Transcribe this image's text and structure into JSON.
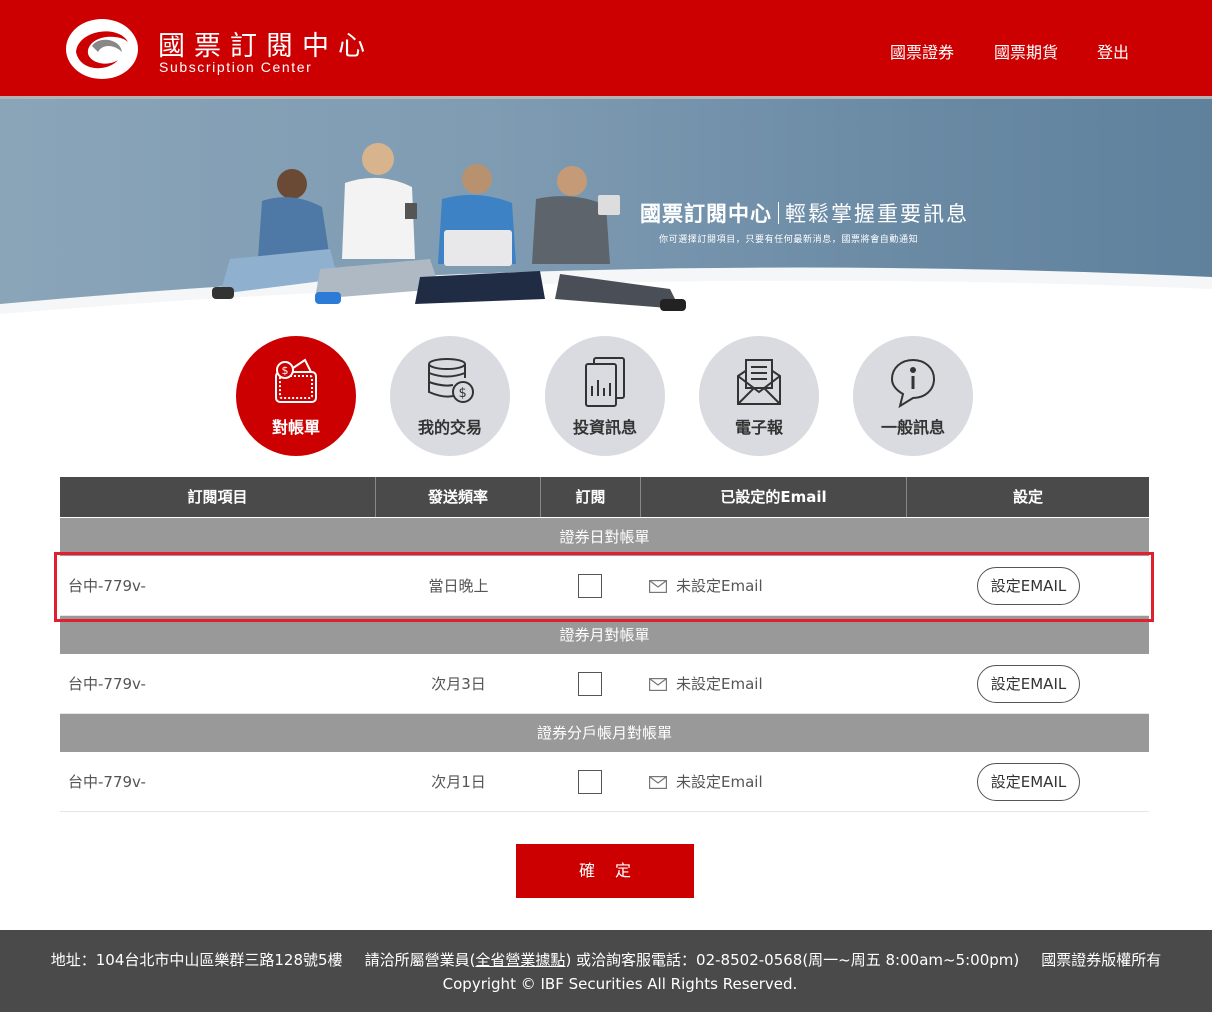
{
  "header": {
    "brand_cn": "國票訂閱中心",
    "brand_en": "Subscription Center",
    "nav": [
      "國票證券",
      "國票期貨",
      "登出"
    ]
  },
  "banner": {
    "title": "國票訂閱中心",
    "slogan": "輕鬆掌握重要訊息",
    "subtitle": "你可選擇訂閱項目，只要有任何最新消息，國票將會自動通知"
  },
  "categories": [
    {
      "label": "對帳單",
      "icon": "wallet-icon",
      "active": true
    },
    {
      "label": "我的交易",
      "icon": "coins-icon",
      "active": false
    },
    {
      "label": "投資訊息",
      "icon": "report-icon",
      "active": false
    },
    {
      "label": "電子報",
      "icon": "newsletter-icon",
      "active": false
    },
    {
      "label": "一般訊息",
      "icon": "info-icon",
      "active": false
    }
  ],
  "table": {
    "headers": [
      "訂閱項目",
      "發送頻率",
      "訂閱",
      "已設定的Email",
      "設定"
    ],
    "groups": [
      {
        "title": "證券日對帳單",
        "row": {
          "item": "台中-779v-",
          "frequency": "當日晚上",
          "subscribed": false,
          "email": "未設定Email",
          "button": "設定EMAIL"
        }
      },
      {
        "title": "證券月對帳單",
        "row": {
          "item": "台中-779v-",
          "frequency": "次月3日",
          "subscribed": false,
          "email": "未設定Email",
          "button": "設定EMAIL"
        }
      },
      {
        "title": "證券分戶帳月對帳單",
        "row": {
          "item": "台中-779v-",
          "frequency": "次月1日",
          "subscribed": false,
          "email": "未設定Email",
          "button": "設定EMAIL"
        }
      }
    ]
  },
  "confirm_label": "確定",
  "footer": {
    "address": "地址：104台北市中山區樂群三路128號5樓",
    "contact_prefix": "請洽所屬營業員(",
    "contact_link": "全省營業據點",
    "contact_suffix": ") 或洽詢客服電話：02-8502-0568(周一~周五 8:00am~5:00pm)",
    "rights_cn": "國票證券版權所有",
    "copyright": "Copyright © IBF Securities All Rights Reserved."
  },
  "colors": {
    "brand_red": "#cc0000",
    "header_gray": "#4a4a4a",
    "group_gray": "#999999",
    "circle_gray": "#d9dbe0",
    "highlight_red": "#e0202f"
  }
}
